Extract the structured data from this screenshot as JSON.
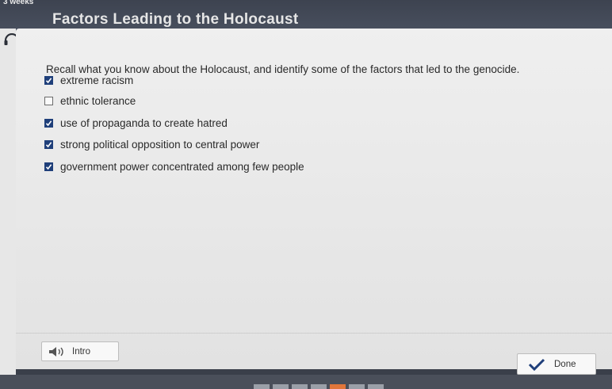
{
  "header": {
    "status_text": "3 weeks",
    "title": "Factors Leading to the Holocaust"
  },
  "question": {
    "prompt": "Recall what you know about the Holocaust, and identify some of the factors that led to the genocide.",
    "options": [
      {
        "label": "extreme racism",
        "checked": true
      },
      {
        "label": "ethnic tolerance",
        "checked": false
      },
      {
        "label": "use of propaganda to create hatred",
        "checked": true
      },
      {
        "label": "strong political opposition to central power",
        "checked": true
      },
      {
        "label": "government power concentrated among few people",
        "checked": true
      }
    ]
  },
  "footer": {
    "intro_label": "Intro",
    "done_label": "Done"
  },
  "icons": {
    "headphones": "headphones-icon",
    "speaker": "speaker-icon",
    "checkmark": "checkmark-icon"
  },
  "colors": {
    "checkbox_checked": "#1f3f7a",
    "done_check": "#1f3f7a",
    "progress_active": "#e2763a"
  }
}
